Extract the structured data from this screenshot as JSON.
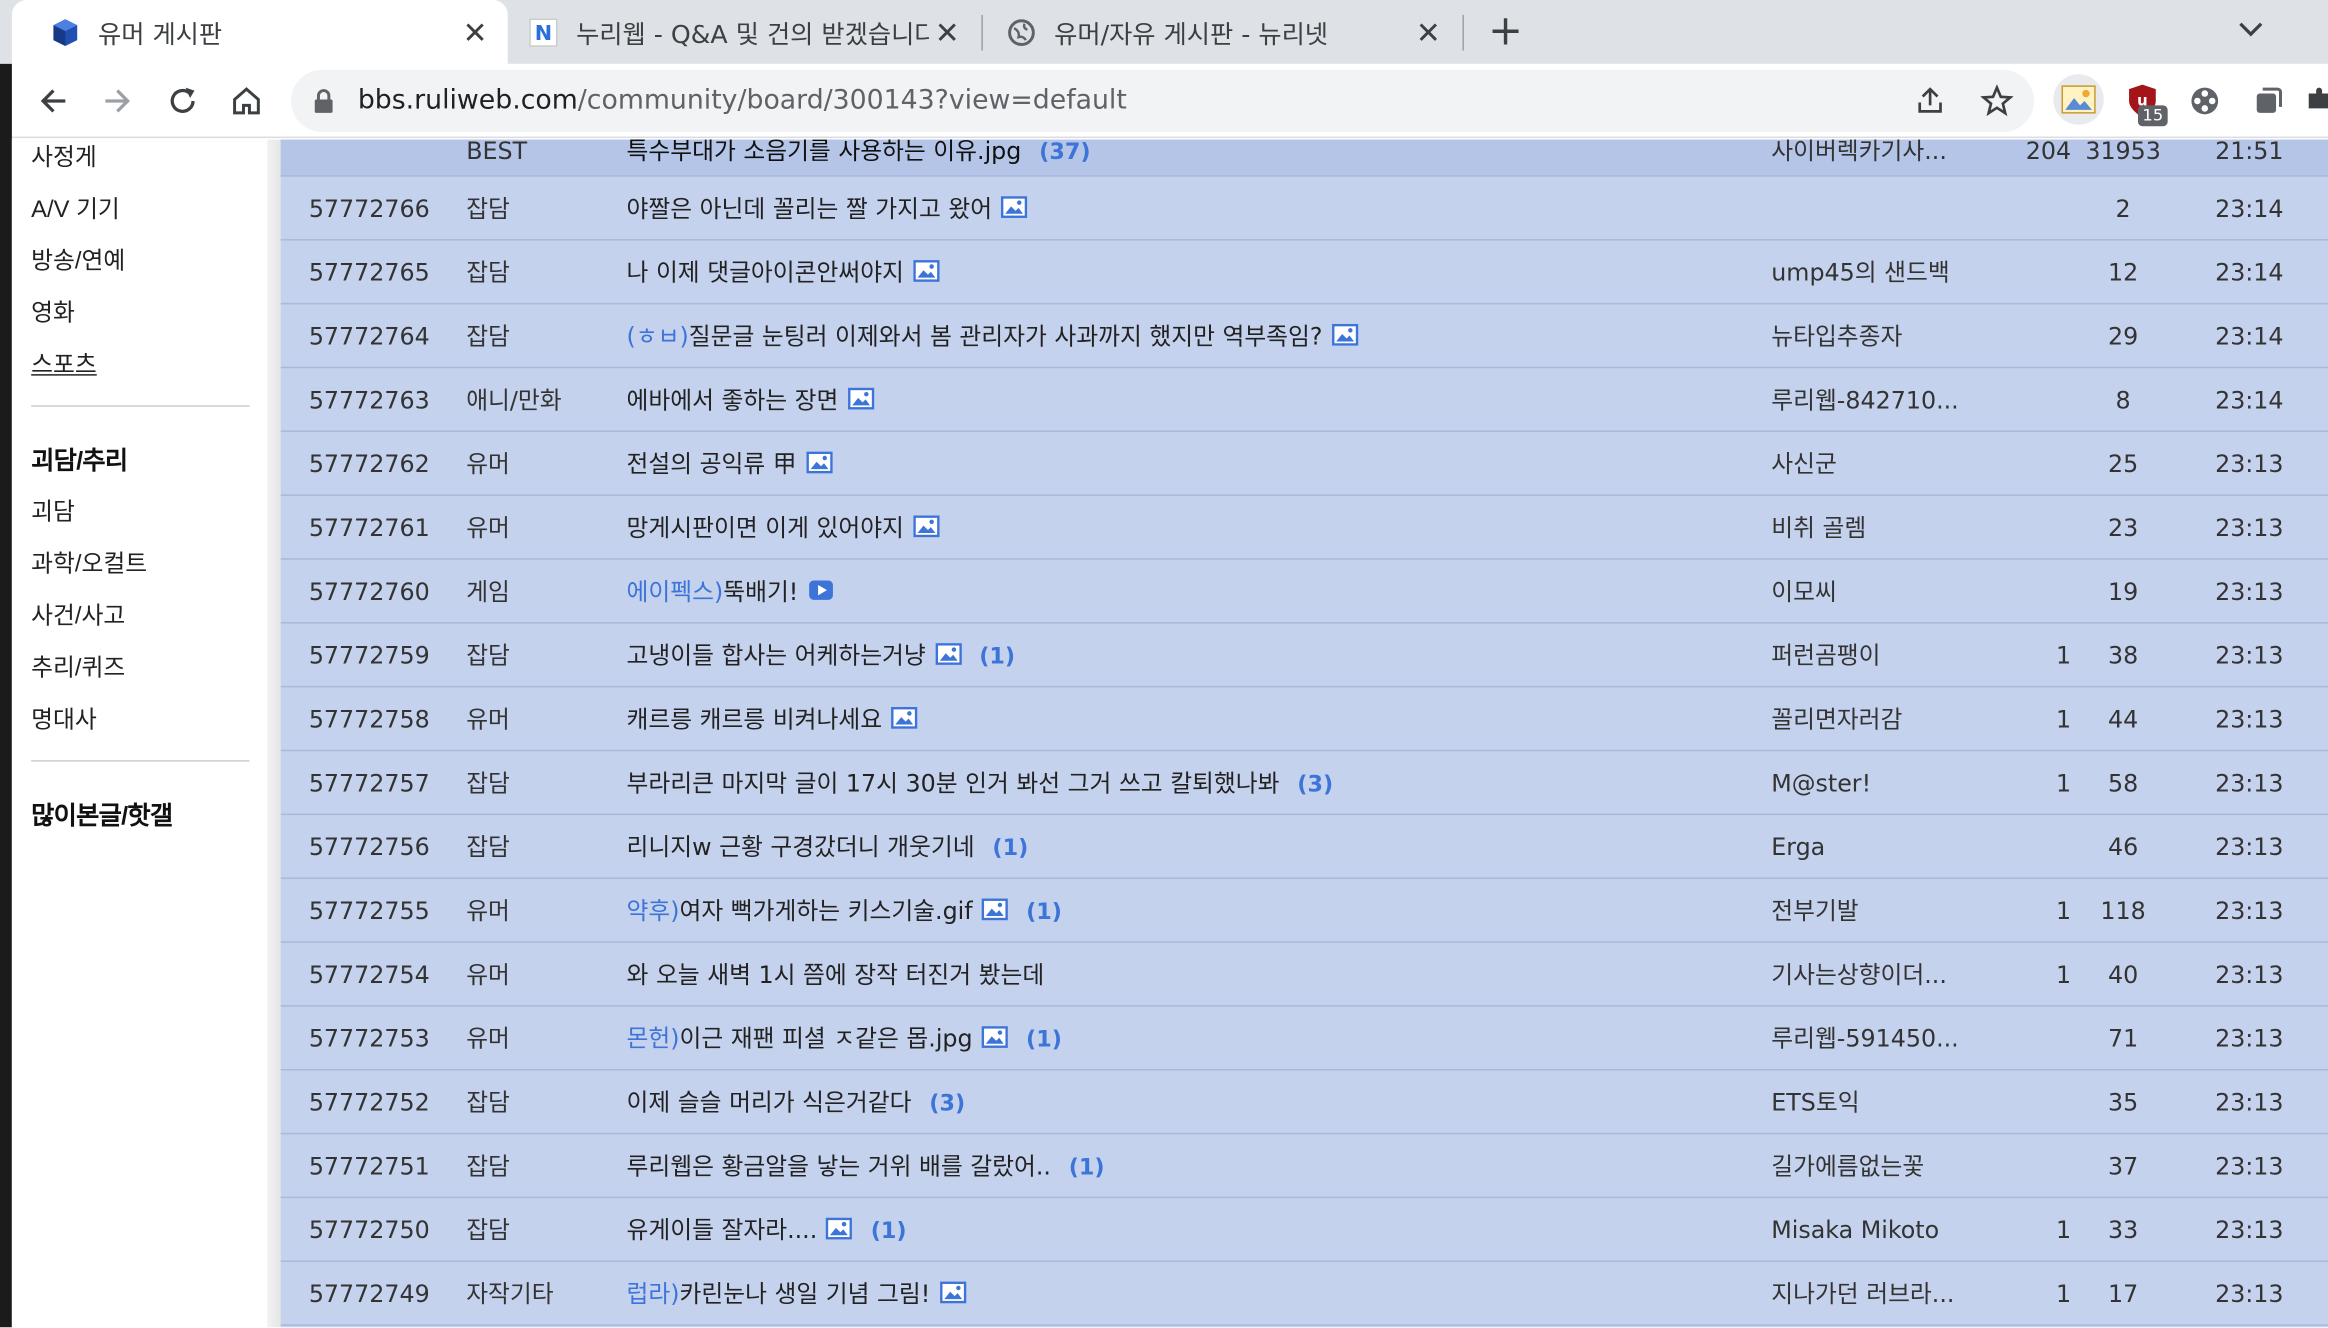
{
  "browser": {
    "tabs": [
      {
        "title": "유머 게시판",
        "active": true,
        "favicon": "ruliweb-cube-icon"
      },
      {
        "title": "누리웹 - Q&A 및 건의 받겠습니다",
        "active": false,
        "favicon": "nuriweb-n-icon"
      },
      {
        "title": "유머/자유 게시판 - 뉴리넷",
        "active": false,
        "favicon": "globe-icon"
      }
    ],
    "url_host": "bbs.ruliweb.com",
    "url_path": "/community/board/300143?view=default",
    "extension_badge": "15"
  },
  "sidebar": {
    "items_top": [
      "사정게",
      "A/V 기기",
      "방송/연예",
      "영화",
      "스포츠"
    ],
    "section_heading": "괴담/추리",
    "items_mid": [
      "괴담",
      "과학/오컬트",
      "사건/사고",
      "추리/퀴즈",
      "명대사"
    ],
    "bottom_heading": "많이본글/핫갤"
  },
  "board": {
    "best_row": {
      "num": "",
      "cat": "BEST",
      "title": "특수부대가 소음기를 사용하는 이유.jpg",
      "comments": "(37)",
      "author": "사이버렉카기사...",
      "rec": "204",
      "hits": "31953",
      "time": "21:51"
    },
    "rows": [
      {
        "num": "57772766",
        "cat": "잡담",
        "prefix": "",
        "title": "야짤은 아닌데 꼴리는 짤 가지고 왔어",
        "icon": "image",
        "comments": "",
        "author": "",
        "rec": "",
        "hits": "2",
        "time": "23:14"
      },
      {
        "num": "57772765",
        "cat": "잡담",
        "prefix": "",
        "title": "나 이제 댓글아이콘안써야지",
        "icon": "image",
        "comments": "",
        "author": "ump45의 샌드백",
        "rec": "",
        "hits": "12",
        "time": "23:14"
      },
      {
        "num": "57772764",
        "cat": "잡담",
        "prefix": "(ㅎㅂ)",
        "title": "질문글 눈팅러 이제와서 봄 관리자가 사과까지 했지만 역부족임?",
        "icon": "image",
        "comments": "",
        "author": "뉴타입추종자",
        "rec": "",
        "hits": "29",
        "time": "23:14"
      },
      {
        "num": "57772763",
        "cat": "애니/만화",
        "prefix": "",
        "title": "에바에서 좋하는 장면",
        "icon": "image",
        "comments": "",
        "author": "루리웹-842710...",
        "rec": "",
        "hits": "8",
        "time": "23:14"
      },
      {
        "num": "57772762",
        "cat": "유머",
        "prefix": "",
        "title": "전설의 공익류 甲",
        "icon": "image",
        "comments": "",
        "author": "사신군",
        "rec": "",
        "hits": "25",
        "time": "23:13"
      },
      {
        "num": "57772761",
        "cat": "유머",
        "prefix": "",
        "title": "망게시판이면 이게 있어야지",
        "icon": "image",
        "comments": "",
        "author": "비취 골렘",
        "rec": "",
        "hits": "23",
        "time": "23:13"
      },
      {
        "num": "57772760",
        "cat": "게임",
        "prefix": "에이펙스)",
        "title": "뚝배기!",
        "icon": "video",
        "comments": "",
        "author": "이모씨",
        "rec": "",
        "hits": "19",
        "time": "23:13"
      },
      {
        "num": "57772759",
        "cat": "잡담",
        "prefix": "",
        "title": "고냉이들 합사는 어케하는거냥",
        "icon": "image",
        "comments": "(1)",
        "author": "퍼런곰팽이",
        "rec": "1",
        "hits": "38",
        "time": "23:13"
      },
      {
        "num": "57772758",
        "cat": "유머",
        "prefix": "",
        "title": "캐르릉 캐르릉 비켜나세요",
        "icon": "image",
        "comments": "",
        "author": "꼴리면자러감",
        "rec": "1",
        "hits": "44",
        "time": "23:13"
      },
      {
        "num": "57772757",
        "cat": "잡담",
        "prefix": "",
        "title": "부라리큰 마지막 글이 17시 30분 인거 봐선 그거 쓰고 칼퇴했나봐",
        "icon": "",
        "comments": "(3)",
        "author": "M@ster!",
        "rec": "1",
        "hits": "58",
        "time": "23:13"
      },
      {
        "num": "57772756",
        "cat": "잡담",
        "prefix": "",
        "title": "리니지w 근황 구경갔더니 개웃기네",
        "icon": "",
        "comments": "(1)",
        "author": "Erga",
        "rec": "",
        "hits": "46",
        "time": "23:13"
      },
      {
        "num": "57772755",
        "cat": "유머",
        "prefix": "약후)",
        "title": "여자 뻑가게하는 키스기술.gif",
        "icon": "image",
        "comments": "(1)",
        "author": "전부기발",
        "rec": "1",
        "hits": "118",
        "time": "23:13"
      },
      {
        "num": "57772754",
        "cat": "유머",
        "prefix": "",
        "title": "와 오늘 새벽 1시 쯤에 장작 터진거 봤는데",
        "icon": "",
        "comments": "",
        "author": "기사는상향이더...",
        "rec": "1",
        "hits": "40",
        "time": "23:13"
      },
      {
        "num": "57772753",
        "cat": "유머",
        "prefix": "몬헌)",
        "title": "이근 재팬 피셜 ㅈ같은 몹.jpg",
        "icon": "image",
        "comments": "(1)",
        "author": "루리웹-591450...",
        "rec": "",
        "hits": "71",
        "time": "23:13"
      },
      {
        "num": "57772752",
        "cat": "잡담",
        "prefix": "",
        "title": "이제 슬슬 머리가 식은거같다",
        "icon": "",
        "comments": "(3)",
        "author": "ETS토익",
        "rec": "",
        "hits": "35",
        "time": "23:13"
      },
      {
        "num": "57772751",
        "cat": "잡담",
        "prefix": "",
        "title": "루리웹은 황금알을 낳는 거위 배를 갈랐어..",
        "icon": "",
        "comments": "(1)",
        "author": "길가에름없는꽃",
        "rec": "",
        "hits": "37",
        "time": "23:13"
      },
      {
        "num": "57772750",
        "cat": "잡담",
        "prefix": "",
        "title": "유게이들 잘자라....",
        "icon": "image",
        "comments": "(1)",
        "author": "Misaka Mikoto",
        "rec": "1",
        "hits": "33",
        "time": "23:13"
      },
      {
        "num": "57772749",
        "cat": "자작기타",
        "prefix": "럽라)",
        "title": "카린눈나 생일 기념 그림!",
        "icon": "image",
        "comments": "",
        "author": "지나가던 러브라...",
        "rec": "1",
        "hits": "17",
        "time": "23:13"
      }
    ]
  },
  "colors": {
    "board_bg": "#c5d2ee",
    "accent": "#3d74d8",
    "tab_strip": "#dee1e6"
  }
}
